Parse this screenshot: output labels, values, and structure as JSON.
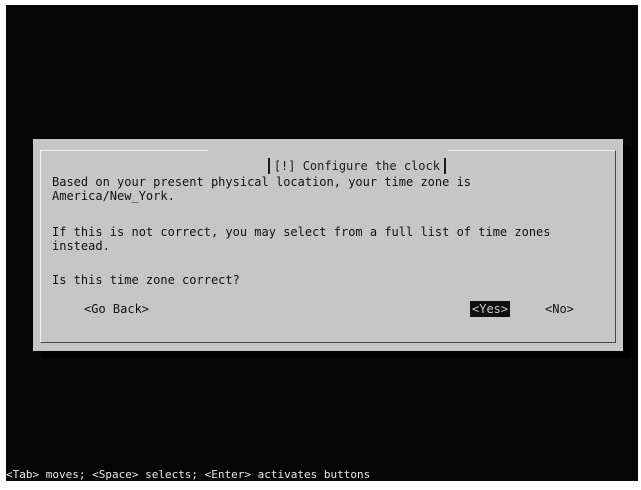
{
  "dialog": {
    "title": "[!] Configure the clock",
    "paragraphs": [
      "Based on your present physical location, your time zone is",
      "America/New_York.",
      "If this is not correct, you may select from a full list of time zones",
      "instead.",
      "Is this time zone correct?"
    ],
    "buttons": {
      "go_back": "<Go Back>",
      "yes": "<Yes>",
      "no": "<No>"
    }
  },
  "status_bar": "<Tab> moves; <Space> selects; <Enter> activates buttons",
  "colors": {
    "screen_background": "#050505",
    "dialog_background": "#c6c6c6",
    "selected_button_background": "#101010"
  }
}
